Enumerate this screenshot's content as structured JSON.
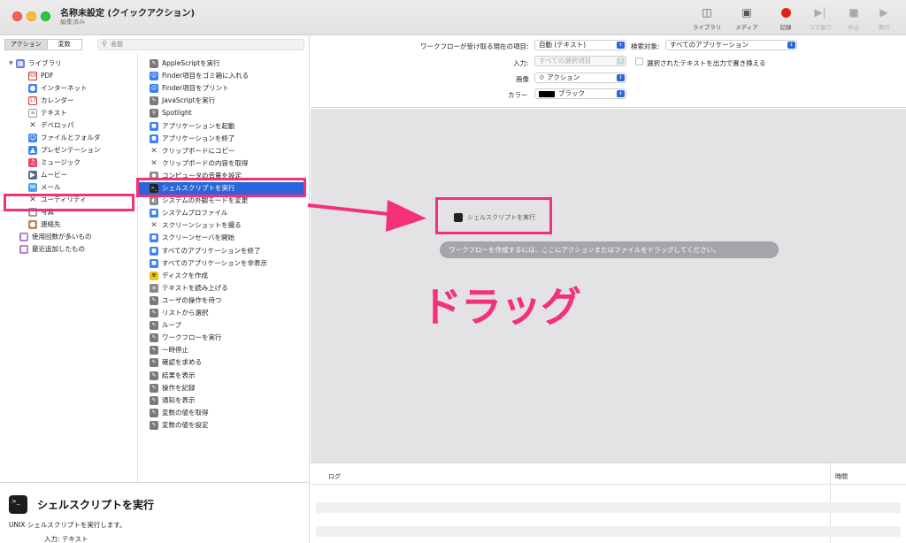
{
  "window": {
    "title": "名称未設定 (クイックアクション)",
    "subtitle": "編集済み"
  },
  "toolbar": {
    "library": "ライブラリ",
    "media": "メディア",
    "record": "記録",
    "step": "コマ送り",
    "stop": "中止",
    "run": "実行"
  },
  "left": {
    "tab_actions": "アクション",
    "tab_variables": "変数",
    "search_placeholder": "名前"
  },
  "library": {
    "root": "ライブラリ",
    "items": [
      "PDF",
      "インターネット",
      "カレンダー",
      "テキスト",
      "デベロッパ",
      "ファイルとフォルダ",
      "プレゼンテーション",
      "ミュージック",
      "ムービー",
      "メール",
      "ユーティリティ",
      "写真",
      "連絡先"
    ],
    "most_used": "使用回数が多いもの",
    "recent": "最近追加したもの"
  },
  "actions": [
    "AppleScriptを実行",
    "Finder項目をゴミ箱に入れる",
    "Finder項目をプリント",
    "JavaScriptを実行",
    "Spotlight",
    "アプリケーションを起動",
    "アプリケーションを終了",
    "クリップボードにコピー",
    "クリップボードの内容を取得",
    "コンピュータの音量を設定",
    "シェルスクリプトを実行",
    "システムの外観モードを変更",
    "システムプロファイル",
    "スクリーンショットを撮る",
    "スクリーンセーバを開始",
    "すべてのアプリケーションを終了",
    "すべてのアプリケーションを非表示",
    "ディスクを作成",
    "テキストを読み上げる",
    "ユーザの操作を待つ",
    "リストから選択",
    "ループ",
    "ワークフローを実行",
    "一時停止",
    "確認を求める",
    "結果を表示",
    "操作を記録",
    "通知を表示",
    "変数の値を取得",
    "変数の値を設定"
  ],
  "description": {
    "title": "シェルスクリプトを実行",
    "text": "UNIX シェルスクリプトを実行します。",
    "input_label": "入力: テキスト"
  },
  "params": {
    "receives_label": "ワークフローが受け取る現在の項目:",
    "receives_value": "自動 (テキスト)",
    "search_label": "検索対象:",
    "search_value": "すべてのアプリケーション",
    "input_label": "入力:",
    "input_value": "すべての選択項目",
    "replace_label": "選択されたテキストを出力で置き換える",
    "image_label": "画像",
    "image_value": "アクション",
    "color_label": "カラー",
    "color_value": "ブラック"
  },
  "workflow": {
    "dragged_item": "シェルスクリプトを実行",
    "hint": "ワークフローを作成するには、ここにアクションまたはファイルをドラッグしてください。",
    "drag_annotation": "ドラッグ"
  },
  "log": {
    "col_log": "ログ",
    "col_time": "時間"
  },
  "colors": {
    "highlight": "#f5307a",
    "selection": "#2a66d8"
  }
}
